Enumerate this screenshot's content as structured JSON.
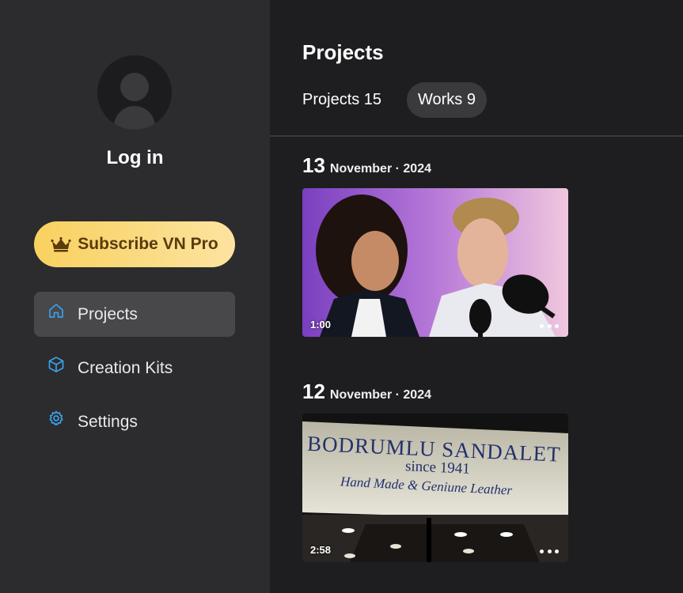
{
  "sidebar": {
    "login_label": "Log in",
    "subscribe_label": "Subscribe VN Pro",
    "items": [
      {
        "label": "Projects",
        "icon": "home-icon",
        "active": true
      },
      {
        "label": "Creation Kits",
        "icon": "cube-icon",
        "active": false
      },
      {
        "label": "Settings",
        "icon": "gear-icon",
        "active": false
      }
    ]
  },
  "main": {
    "title": "Projects",
    "tabs": [
      {
        "label": "Projects 15",
        "selected": false
      },
      {
        "label": "Works 9",
        "selected": true
      }
    ],
    "groups": [
      {
        "day": "13",
        "month_year": "November · 2024",
        "works": [
          {
            "duration": "1:00"
          }
        ]
      },
      {
        "day": "12",
        "month_year": "November · 2024",
        "works": [
          {
            "duration": "2:58"
          }
        ]
      }
    ],
    "sign": {
      "line1": "BODRUMLU SANDALET",
      "line2": "since 1941",
      "line3": "Hand Made & Geniune Leather"
    }
  },
  "colors": {
    "accent": "#3aa0e8",
    "subscribe_start": "#f9d15f",
    "subscribe_end": "#fce3a0",
    "sidebar_bg": "#2c2c2e",
    "main_bg": "#1e1e21"
  }
}
